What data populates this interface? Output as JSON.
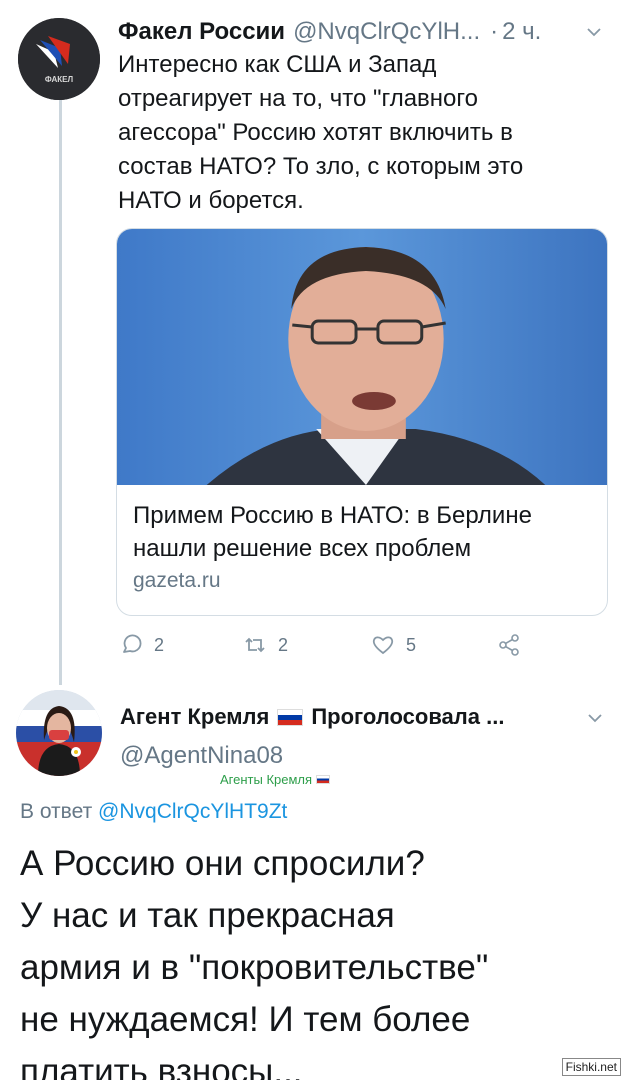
{
  "tweet1": {
    "author_name": "Факел России",
    "handle": "@NvqClrQcYlH...",
    "dot": "·",
    "time": "2 ч.",
    "avatar_label": "ФАКЕЛ",
    "text_lines": [
      "Интересно как США и Запад",
      "отреагирует на то, что \"главного",
      "агессора\" Россию хотят включить в",
      "состав НАТО? То зло, с которым это",
      "НАТО и борется."
    ],
    "card": {
      "title_lines": [
        "Примем Россию в НАТО: в Берлине",
        "нашли решение всех проблем"
      ],
      "domain": "gazeta.ru"
    },
    "actions": {
      "reply_count": "2",
      "retweet_count": "2",
      "like_count": "5"
    },
    "icons": [
      "comment-icon",
      "retweet-icon",
      "heart-icon",
      "share-icon",
      "chevron-down-icon"
    ]
  },
  "tweet2": {
    "name_part1": "Агент Кремля",
    "name_part2": "Проголосовала ...",
    "handle": "@AgentNina08",
    "group_label": "Агенты Кремля",
    "reply_prefix": "В ответ",
    "reply_handle": "@NvqClrQcYlHT9Zt",
    "text_lines": [
      "А Россию они спросили?",
      "У нас и так прекрасная",
      "армия и в \"покровительстве\"",
      "не нуждаемся! И тем более",
      "платить взносы..."
    ]
  },
  "watermark": "Fishki.net",
  "colors": {
    "text": "#14171a",
    "secondary": "#657786",
    "link": "#1b95e0",
    "thread_line": "#ccd6dd",
    "card_border": "#d4dde4",
    "group_green": "#2d9e4a"
  }
}
